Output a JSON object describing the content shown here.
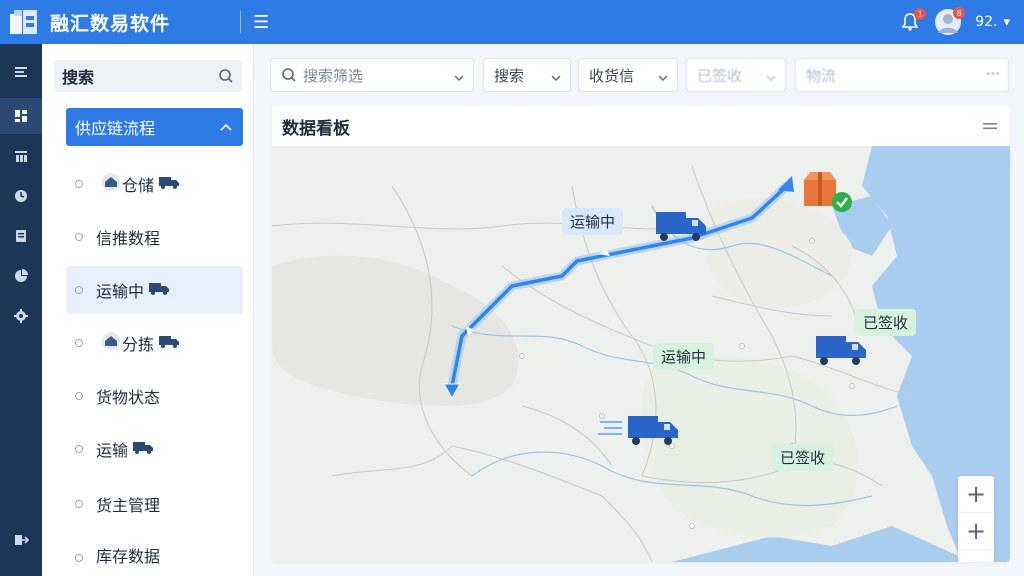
{
  "header": {
    "app_title": "融汇数易软件",
    "menu_glyph": "☰",
    "notif_count": "1",
    "avatar_badge": "8",
    "user_name": "92.",
    "user_chevron": "▾"
  },
  "rail": {
    "icons": [
      "menu-icon",
      "dashboard-icon",
      "building-icon",
      "clock-icon",
      "document-icon",
      "chart-icon",
      "settings-icon",
      "logout-icon"
    ]
  },
  "sidebar": {
    "search_label": "搜索",
    "group_label": "供应链流程",
    "items": [
      {
        "label": "仓储",
        "icon_before": "warehouse-icon",
        "icon_after": "truck-icon"
      },
      {
        "label": "信推数程"
      },
      {
        "label": "运输中",
        "icon_after": "truck-icon"
      },
      {
        "label": "分拣",
        "icon_before": "warehouse-icon",
        "icon_after": "truck-icon"
      },
      {
        "label": "货物状态"
      },
      {
        "label": "运输",
        "icon_after": "truck-icon"
      },
      {
        "label": "货主管理"
      },
      {
        "label": "库存数据"
      }
    ]
  },
  "toolbar": {
    "search_placeholder": "搜索筛选",
    "filter1": "搜索",
    "filter2": "收货信",
    "filter3": "已签收",
    "filter4": "物流",
    "more_glyph": "···"
  },
  "panel": {
    "title": "数据看板",
    "menu_glyph": "═"
  },
  "map": {
    "labels": {
      "in_transit_1": "运输中",
      "in_transit_2": "运输中",
      "signed_1": "已签收",
      "signed_2": "已签收"
    },
    "zoom": [
      "+",
      "+",
      "−"
    ],
    "route_color": "#2f86f0",
    "truck_color": "#2a66c9",
    "delivered_color": "#e8763a",
    "check_color": "#2bb04a"
  }
}
